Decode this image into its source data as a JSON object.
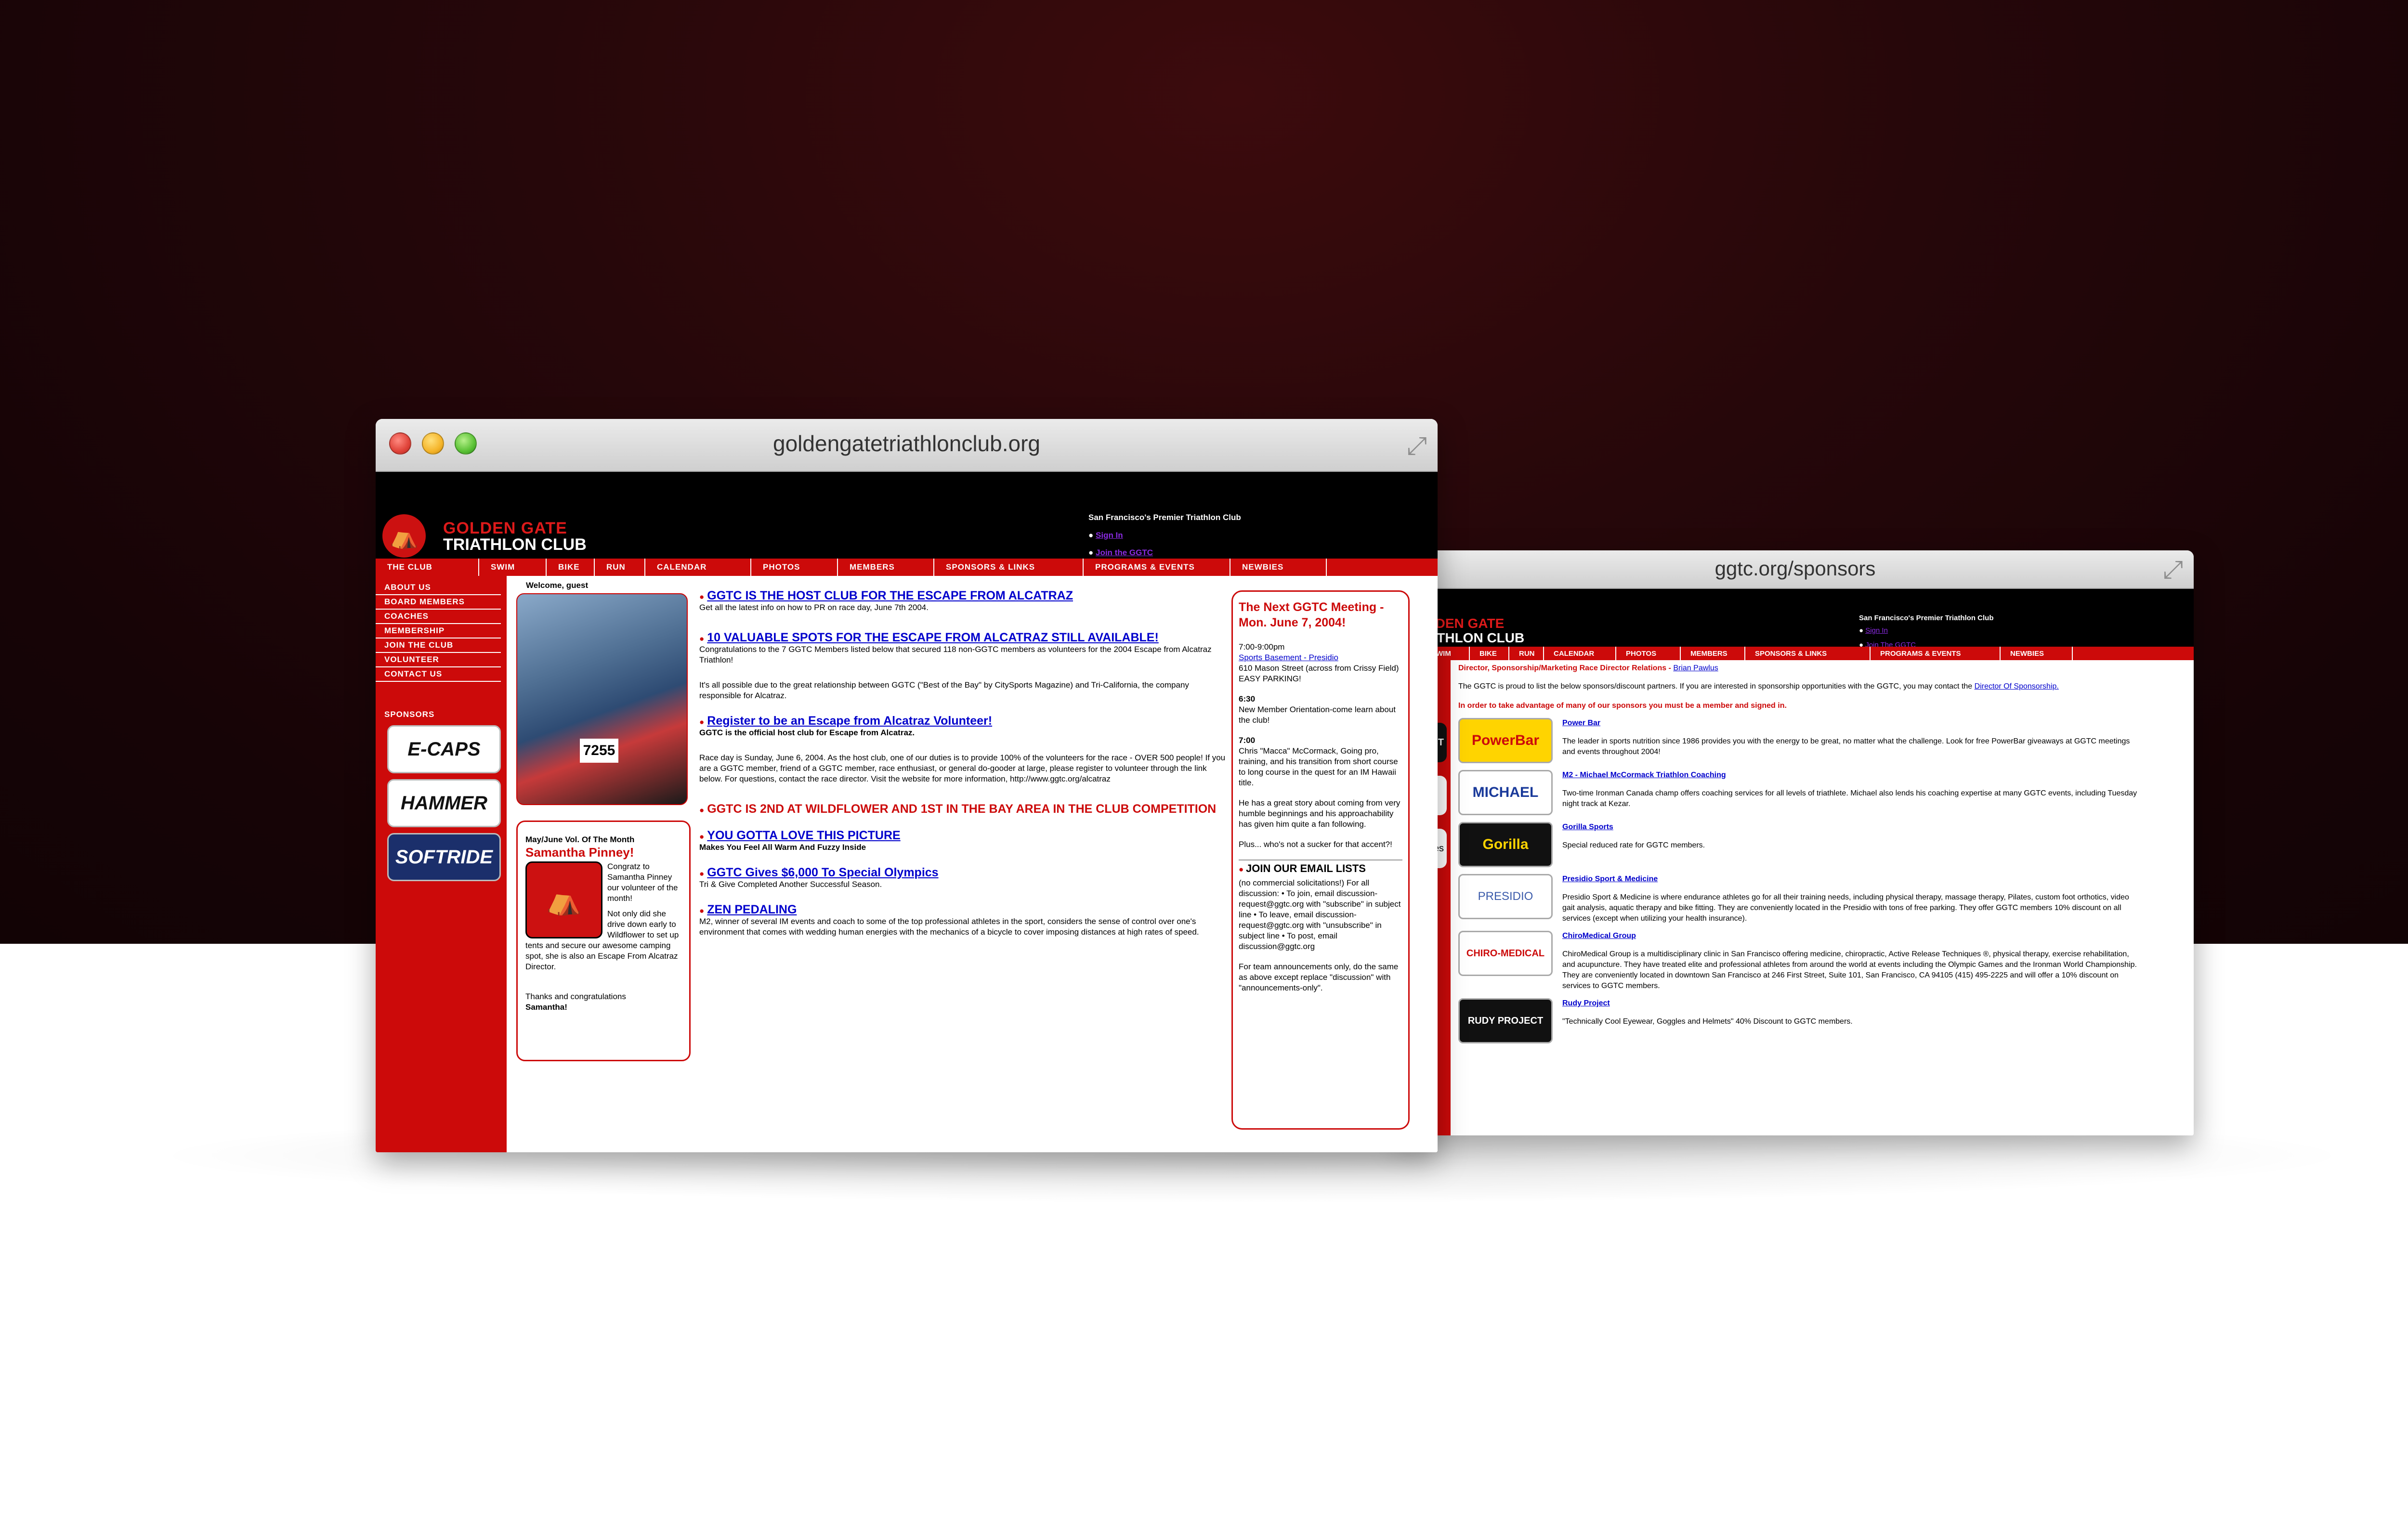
{
  "main_window": {
    "url": "goldengatetriathlonclub.org",
    "header": {
      "logo_line1": "GOLDEN GATE",
      "logo_line2": "TRIATHLON CLUB",
      "tagline": "San Francisco's Premier Triathlon Club",
      "sign_in": "Sign In",
      "join": "Join the GGTC"
    },
    "nav": [
      "THE CLUB",
      "SWIM",
      "BIKE",
      "RUN",
      "CALENDAR",
      "PHOTOS",
      "MEMBERS",
      "SPONSORS & LINKS",
      "PROGRAMS & EVENTS",
      "NEWBIES"
    ],
    "sidebar": {
      "items": [
        "ABOUT US",
        "BOARD MEMBERS",
        "COACHES",
        "MEMBERSHIP",
        "JOIN THE CLUB",
        "VOLUNTEER",
        "CONTACT US"
      ],
      "sponsors_title": "SPONSORS",
      "sponsor_logos": [
        "E-CAPS",
        "HAMMER",
        "SOFTRIDE"
      ]
    },
    "welcome": "Welcome, guest",
    "photo_bib": "7255",
    "volunteer": {
      "heading": "May/June Vol. Of The Month",
      "name": "Samantha Pinney!",
      "text1": "Congratz to Samantha Pinney our volunteer of the month!",
      "text2": "Not only did she drive down early to Wildflower to set up tents and secure our awesome camping spot, she is also an Escape From Alcatraz Director.",
      "thanks": "Thanks and congratulations",
      "thanks_name": "Samantha!"
    },
    "news": [
      {
        "title": "GGTC IS THE HOST CLUB FOR THE ESCAPE FROM ALCATRAZ",
        "body": "Get all the latest info on how to PR on race day, June 7th 2004."
      },
      {
        "title": "10 VALUABLE SPOTS FOR THE ESCAPE FROM ALCATRAZ STILL AVAILABLE!",
        "body": "Congratulations to the 7 GGTC Members listed below that secured 118 non-GGTC members as volunteers for the 2004 Escape from Alcatraz Triathlon!"
      },
      {
        "title": "",
        "body": "It's all possible due to the great relationship between GGTC (\"Best of the Bay\" by CitySports Magazine) and Tri-California, the company responsible for Alcatraz."
      },
      {
        "title": "Register to be an Escape from Alcatraz Volunteer!",
        "body": "GGTC is the official host club for Escape from Alcatraz."
      },
      {
        "title": "",
        "body": "Race day is Sunday, June 6, 2004. As the host club, one of our duties is to provide 100% of the volunteers for the race - OVER 500 people! If you are a GGTC member, friend of a GGTC member, race enthusiast, or general do-gooder at large, please register to volunteer through the link below. For questions, contact the race director. Visit the website for more information, http://www.ggtc.org/alcatraz"
      },
      {
        "title": "GGTC IS 2ND AT WILDFLOWER AND 1ST IN THE BAY AREA IN THE CLUB COMPETITION",
        "body": ""
      },
      {
        "title": "YOU GOTTA LOVE THIS PICTURE",
        "body": "Makes You Feel All Warm And Fuzzy Inside"
      },
      {
        "title": "GGTC Gives $6,000 To Special Olympics",
        "body": "Tri & Give Completed Another Successful Season."
      },
      {
        "title": "ZEN PEDALING",
        "body": "M2, winner of several IM events and coach to some of the top professional athletes in the sport, considers the sense of control over one's environment that comes with wedding human energies with the mechanics of a bicycle to cover imposing distances at high rates of speed."
      }
    ],
    "meeting": {
      "title": "The Next GGTC Meeting - Mon. June 7, 2004!",
      "time": "7:00-9:00pm",
      "location_link": "Sports Basement - Presidio",
      "address": "610 Mason Street (across from Crissy Field) EASY PARKING!",
      "t1": "6:30",
      "t1_text": "New Member Orientation-come learn about the club!",
      "t2": "7:00",
      "t2_text": "Chris \"Macca\" McCormack, Going pro, training, and his transition from short course to long course in the quest for an IM Hawaii title.",
      "p3": "He has a great story about coming from very humble beginnings and his approachability has given him quite a fan following.",
      "p4": "Plus... who's not a sucker for that accent?!",
      "lists_title": "JOIN OUR EMAIL LISTS",
      "lists_text": "(no commercial solicitations!) For all discussion: • To join, email discussion-request@ggtc.org with \"subscribe\" in subject line • To leave, email discussion-request@ggtc.org with \"unsubscribe\" in subject line • To post, email discussion@ggtc.org",
      "lists_footer": "For team announcements only, do the same as above except replace \"discussion\" with \"announcements-only\"."
    }
  },
  "sponsor_window": {
    "url": "ggtc.org/sponsors",
    "header": {
      "logo_line1": "GOLDEN GATE",
      "logo_line2": "TRIATHLON CLUB",
      "tagline": "San Francisco's Premier Triathlon Club",
      "sign_in": "Sign In",
      "join": "Join The GGTC"
    },
    "nav": [
      "SWIM",
      "BIKE",
      "RUN",
      "CALENDAR",
      "PHOTOS",
      "MEMBERS",
      "SPONSORS & LINKS",
      "PROGRAMS & EVENTS",
      "NEWBIES"
    ],
    "side_stubs": [
      "PROJECT",
      "",
      "athletes"
    ],
    "director": "Director, Sponsorship/Marketing Race Director Relations -",
    "director_name": "Brian Pawlus",
    "intro": "The GGTC is proud to list the below sponsors/discount partners. If you are interested in sponsorship opportunities with the GGTC, you may contact the",
    "intro_link": "Director Of Sponsorship.",
    "notice": "In order to take advantage of many of our sponsors you must be a member and signed in.",
    "sponsors": [
      {
        "logo": "PowerBar",
        "name": "Power Bar",
        "text": "The leader in sports nutrition since 1986 provides you with the energy to be great, no matter what the challenge. Look for free PowerBar giveaways at GGTC meetings and events throughout 2004!"
      },
      {
        "logo": "MICHAEL",
        "name": "M2 - Michael McCormack Triathlon Coaching",
        "text": "Two-time Ironman Canada champ offers coaching services for all levels of triathlete. Michael also lends his coaching expertise at many GGTC events, including Tuesday night track at Kezar."
      },
      {
        "logo": "Gorilla",
        "name": "Gorilla Sports",
        "text": "Special reduced rate for GGTC members."
      },
      {
        "logo": "PRESIDIO",
        "name": "Presidio Sport & Medicine",
        "text": "Presidio Sport & Medicine is where endurance athletes go for all their training needs, including physical therapy, massage therapy, Pilates, custom foot orthotics, video gait analysis, aquatic therapy and bike fitting. They are conveniently located in the Presidio with tons of free parking. They offer GGTC members 10% discount on all services (except when utilizing your health insurance)."
      },
      {
        "logo": "CHIRO-MEDICAL",
        "name": "ChiroMedical Group",
        "text": "ChiroMedical Group is a multidisciplinary clinic in San Francisco offering medicine, chiropractic, Active Release Techniques ®, physical therapy, exercise rehabilitation, and acupuncture. They have treated elite and professional athletes from around the world at events including the Olympic Games and the Ironman World Championship. They are conveniently located in downtown San Francisco at 246 First Street, Suite 101, San Francisco, CA 94105 (415) 495-2225 and will offer a 10% discount on services to GGTC members."
      },
      {
        "logo": "RUDY PROJECT",
        "name": "Rudy Project",
        "text": "\"Technically Cool Eyewear, Goggles and Helmets\" 40% Discount to GGTC members."
      }
    ]
  }
}
